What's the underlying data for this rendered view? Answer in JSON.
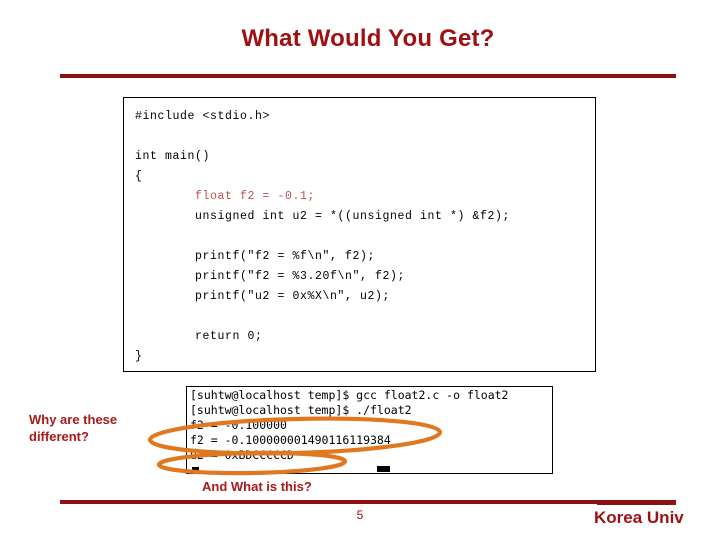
{
  "slide": {
    "title": "What Would You Get?",
    "page_number": "5",
    "brand": "Korea Univ",
    "accent_color": "#8d1113",
    "title_color": "#9e1011",
    "annotation_color": "#a81919",
    "highlight_color": "#e07820",
    "code_keyword_color": "#c0504d"
  },
  "code_block": {
    "language": "c",
    "lines": [
      {
        "text": "#include <stdio.h>",
        "style": "plain"
      },
      {
        "text": "",
        "style": "blank"
      },
      {
        "text": "int main()",
        "style": "plain"
      },
      {
        "text": "{",
        "style": "plain"
      },
      {
        "text": "        float f2 = -0.1;",
        "style": "red"
      },
      {
        "text": "        unsigned int u2 = *((unsigned int *) &f2);",
        "style": "plain"
      },
      {
        "text": "",
        "style": "blank"
      },
      {
        "text": "        printf(\"f2 = %f\\n\", f2);",
        "style": "plain"
      },
      {
        "text": "        printf(\"f2 = %3.20f\\n\", f2);",
        "style": "plain"
      },
      {
        "text": "        printf(\"u2 = 0x%X\\n\", u2);",
        "style": "plain"
      },
      {
        "text": "",
        "style": "blank"
      },
      {
        "text": "        return 0;",
        "style": "plain"
      },
      {
        "text": "}",
        "style": "plain"
      }
    ]
  },
  "terminal": {
    "lines": [
      "[suhtw@localhost temp]$ gcc float2.c -o float2",
      "[suhtw@localhost temp]$ ./float2",
      "f2 = -0.100000",
      "f2 = -0.100000001490116119384",
      "u2 = 0xBDCCCCCD"
    ]
  },
  "annotations": {
    "left_note": "Why are these different?",
    "bottom_note": "And What is this?",
    "ellipse_big_label": "highlight-ellipse-f2-values",
    "ellipse_small_label": "highlight-ellipse-u2-value"
  }
}
